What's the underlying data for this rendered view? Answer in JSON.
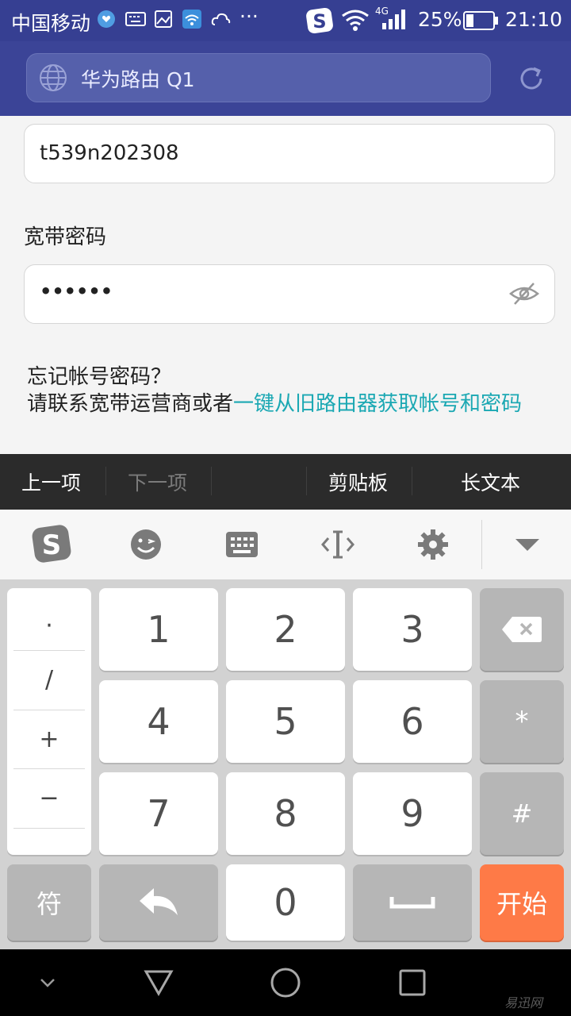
{
  "status_bar": {
    "carrier": "中国移动",
    "network": "4G",
    "battery": "25%",
    "time": "21:10",
    "more": "···"
  },
  "browser": {
    "url_title": "华为路由 Q1"
  },
  "form": {
    "account_value": "t539n202308",
    "password_label": "宽带密码",
    "password_value": "••••••",
    "forgot_title": "忘记帐号密码？",
    "forgot_prefix": "请联系宽带运营商或者",
    "forgot_link": "一键从旧路由器获取帐号和密码"
  },
  "toolbar": {
    "prev": "上一项",
    "next": "下一项",
    "clipboard": "剪贴板",
    "long_text": "长文本"
  },
  "keyboard": {
    "symbols": [
      "·",
      "/",
      "+",
      "−"
    ],
    "digits": [
      "1",
      "2",
      "3",
      "4",
      "5",
      "6",
      "7",
      "8",
      "9",
      "0"
    ],
    "star": "*",
    "hash": "#",
    "symbol_key": "符",
    "start_key": "开始"
  },
  "watermark": "易迅网",
  "colors": {
    "header": "#3b4497",
    "link": "#1ba8b3",
    "start_key": "#fe7a47"
  }
}
